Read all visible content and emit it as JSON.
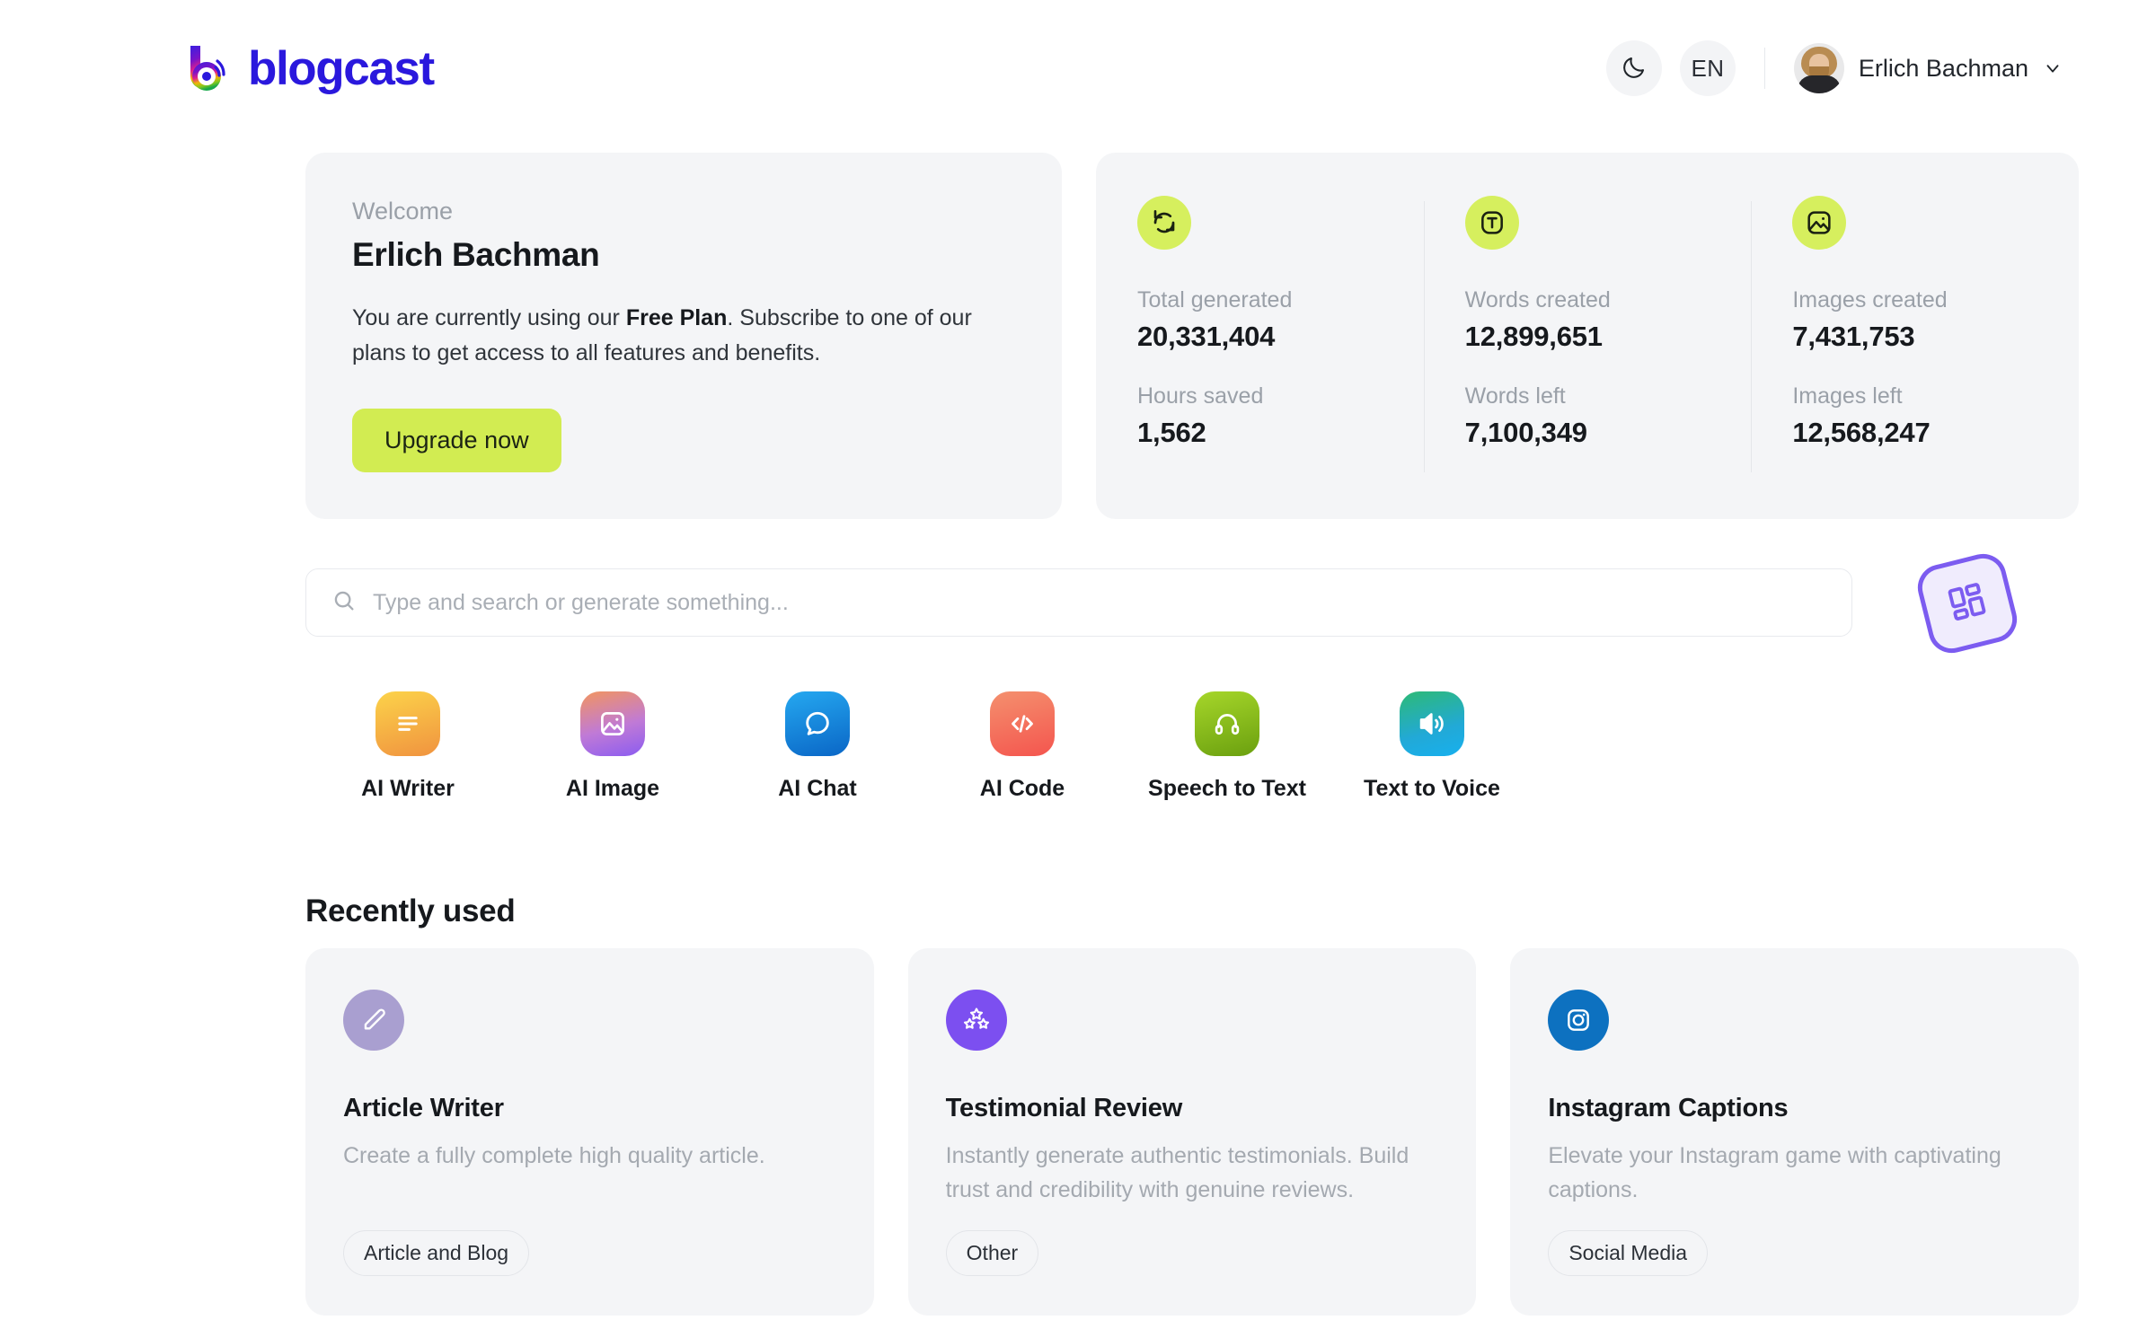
{
  "header": {
    "logo_text": "blogcast",
    "logo_icon": "blogcast-b-mark-icon",
    "theme_toggle_icon": "moon-icon",
    "language": "EN",
    "user_name": "Erlich Bachman",
    "chevron_icon": "chevron-down-icon",
    "avatar_icon": "user-avatar-photo"
  },
  "welcome": {
    "label": "Welcome",
    "name": "Erlich Bachman",
    "text_before": "You are currently using our ",
    "plan": "Free Plan",
    "text_after": ". Subscribe to one of our plans to get access to all features and benefits.",
    "upgrade_label": "Upgrade now"
  },
  "stats": {
    "columns": [
      {
        "icon": "refresh-sync-icon",
        "primary_label": "Total generated",
        "primary_value": "20,331,404",
        "secondary_label": "Hours saved",
        "secondary_value": "1,562"
      },
      {
        "icon": "text-t-icon",
        "primary_label": "Words created",
        "primary_value": "12,899,651",
        "secondary_label": "Words left",
        "secondary_value": "7,100,349"
      },
      {
        "icon": "image-picture-icon",
        "primary_label": "Images created",
        "primary_value": "7,431,753",
        "secondary_label": "Images left",
        "secondary_value": "12,568,247"
      }
    ]
  },
  "search": {
    "placeholder": "Type and search or generate something...",
    "value": "",
    "icon": "search-icon"
  },
  "floating_widget": {
    "icon": "grid-dashboard-icon"
  },
  "quick_actions": [
    {
      "label": "AI Writer",
      "icon": "text-lines-icon"
    },
    {
      "label": "AI Image",
      "icon": "image-picture-icon"
    },
    {
      "label": "AI Chat",
      "icon": "chat-bubble-icon"
    },
    {
      "label": "AI Code",
      "icon": "code-brackets-icon"
    },
    {
      "label": "Speech to Text",
      "icon": "headphones-icon"
    },
    {
      "label": "Text to Voice",
      "icon": "speaker-volume-icon"
    }
  ],
  "recently_used": {
    "title": "Recently used",
    "cards": [
      {
        "icon": "pencil-edit-icon",
        "title": "Article Writer",
        "description": "Create a fully complete high quality article.",
        "tag": "Article and Blog"
      },
      {
        "icon": "three-stars-icon",
        "title": "Testimonial Review",
        "description": "Instantly generate authentic testimonials. Build trust and credibility with genuine reviews.",
        "tag": "Other"
      },
      {
        "icon": "instagram-camera-icon",
        "title": "Instagram Captions",
        "description": "Elevate your Instagram game with captivating captions.",
        "tag": "Social Media"
      }
    ]
  },
  "colors": {
    "accent_lime": "#d2ec52",
    "stat_icon_bg": "#d6ef5e",
    "brand_blue": "#2a18dd",
    "card_bg": "#f4f5f7",
    "widget_purple": "#7c5cf0"
  }
}
